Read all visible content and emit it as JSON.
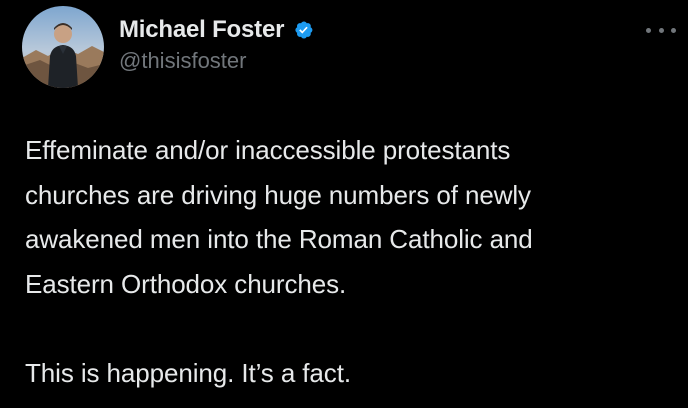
{
  "tweet": {
    "author": {
      "display_name": "Michael Foster",
      "handle": "@thisisfoster",
      "verified": true,
      "verified_color": "#1d9bf0"
    },
    "more_icon": "more-horizontal-icon",
    "text_lines": [
      "Effeminate and/or inaccessible protestants",
      "churches are driving huge numbers of newly",
      "awakened men into the Roman Catholic and",
      "Eastern Orthodox churches."
    ],
    "text_paragraph_2": "This is happening. It’s a fact."
  }
}
